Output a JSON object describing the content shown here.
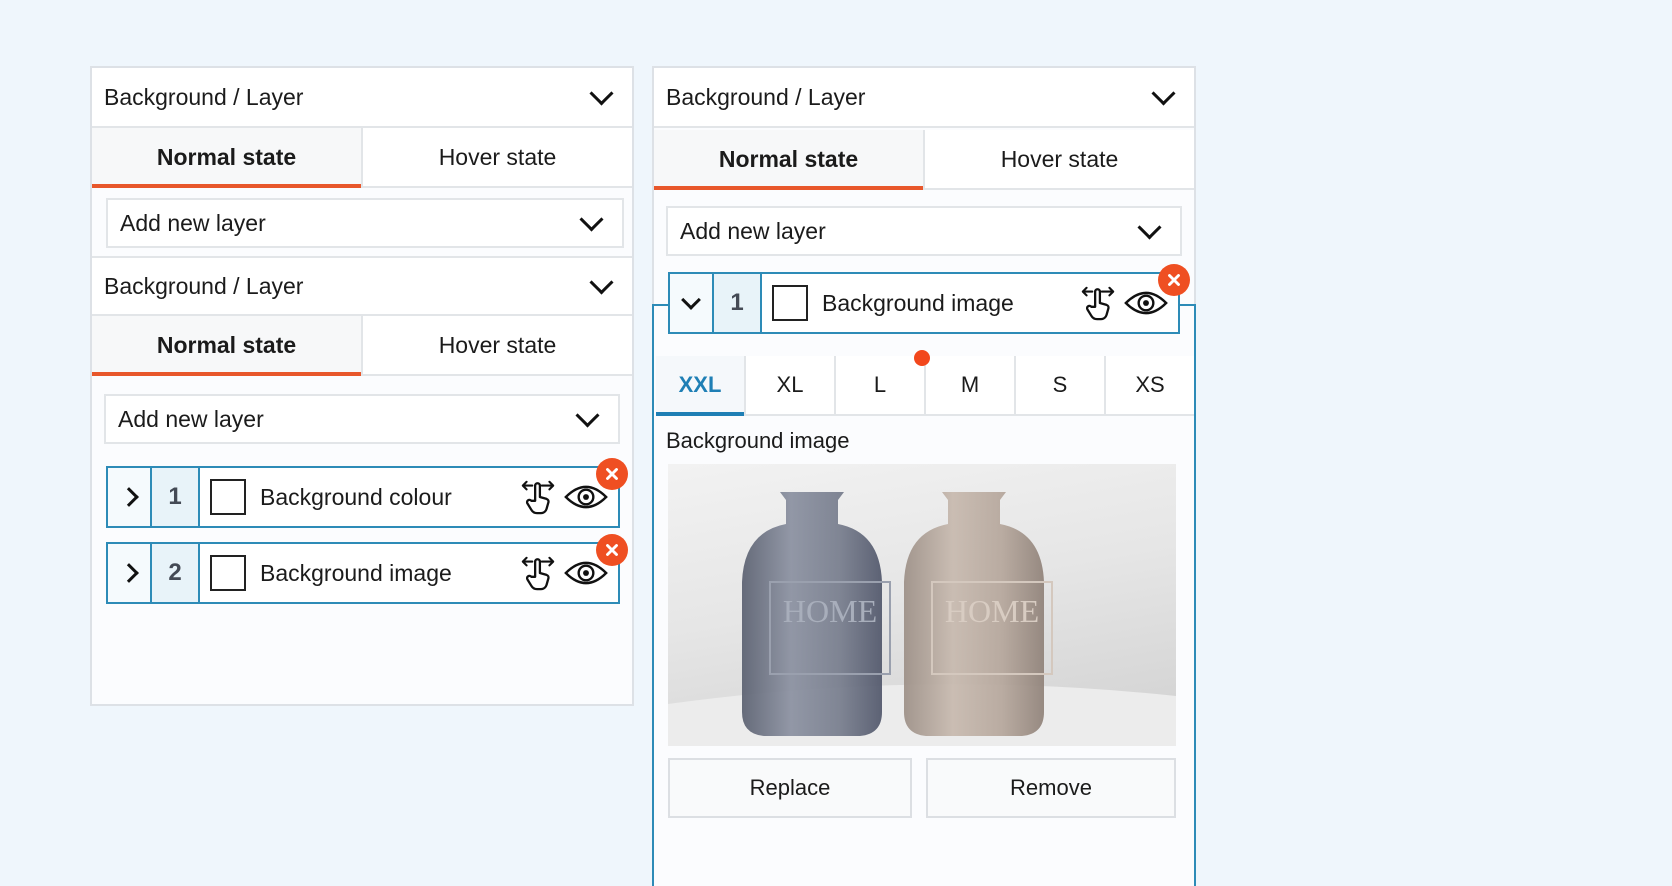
{
  "colors": {
    "accent_orange": "#e8572b",
    "accent_blue": "#2d8bb7",
    "active_breakpoint": "#1f7fb5",
    "remove_red": "#ef4f22",
    "page_background": "#eff6fc"
  },
  "left_panel": {
    "header": {
      "label": "Background / Layer",
      "icon": "chevron-down-icon"
    },
    "tabs": [
      {
        "label": "Normal state",
        "active": true
      },
      {
        "label": "Hover state",
        "active": false
      }
    ],
    "add_layer": {
      "label": "Add new layer",
      "icon": "chevron-down-icon"
    },
    "nested": {
      "header": {
        "label": "Background / Layer",
        "icon": "chevron-down-icon"
      },
      "tabs": [
        {
          "label": "Normal state",
          "active": true
        },
        {
          "label": "Hover state",
          "active": false
        }
      ],
      "add_layer": {
        "label": "Add new layer",
        "icon": "chevron-down-icon"
      },
      "layers": [
        {
          "number": "1",
          "name": "Background colour",
          "expanded": false,
          "checked": false,
          "icons": [
            "chevron-right-icon",
            "drag-hand-icon",
            "eye-icon",
            "remove-icon"
          ]
        },
        {
          "number": "2",
          "name": "Background image",
          "expanded": false,
          "checked": false,
          "icons": [
            "chevron-right-icon",
            "drag-hand-icon",
            "eye-icon",
            "remove-icon"
          ]
        }
      ]
    }
  },
  "right_panel": {
    "header": {
      "label": "Background / Layer",
      "icon": "chevron-down-icon"
    },
    "tabs": [
      {
        "label": "Normal state",
        "active": true
      },
      {
        "label": "Hover state",
        "active": false
      }
    ],
    "add_layer": {
      "label": "Add new layer",
      "icon": "chevron-down-icon"
    },
    "layers": [
      {
        "number": "1",
        "name": "Background image",
        "expanded": true,
        "checked": false,
        "icons": [
          "chevron-down-icon",
          "drag-hand-icon",
          "eye-icon",
          "remove-icon"
        ]
      }
    ],
    "breakpoints": [
      {
        "label": "XXL",
        "active": true,
        "modified": false
      },
      {
        "label": "XL",
        "active": false,
        "modified": false
      },
      {
        "label": "L",
        "active": false,
        "modified": true
      },
      {
        "label": "M",
        "active": false,
        "modified": false
      },
      {
        "label": "S",
        "active": false,
        "modified": false
      },
      {
        "label": "XS",
        "active": false,
        "modified": false
      }
    ],
    "image_section": {
      "label": "Background image",
      "image_alt": "Two glass bottles (grey and amber) embossed with HOME",
      "bottle_text": "HOME",
      "replace_label": "Replace",
      "remove_label": "Remove"
    }
  }
}
